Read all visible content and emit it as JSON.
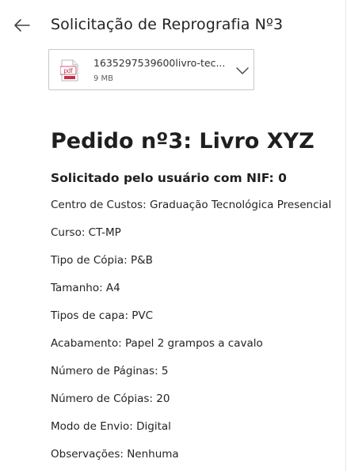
{
  "header": {
    "title": "Solicitação de Reprografia Nº3"
  },
  "attachment": {
    "file_name": "1635297539600livro-tec...",
    "file_size": "9 MB",
    "file_type_label": "pdf",
    "icon": "pdf-file-icon"
  },
  "colors": {
    "pdf_icon": "#c4314b",
    "text": "#242424"
  },
  "order": {
    "title": "Pedido nº3: Livro XYZ",
    "requested_by": "Solicitado pelo usuário com NIF: 0",
    "details": [
      "Centro de Custos: Graduação Tecnológica Presencial",
      "Curso: CT-MP",
      "Tipo de Cópia: P&B",
      "Tamanho: A4",
      "Tipos de capa: PVC",
      "Acabamento: Papel 2 grampos a cavalo",
      "Número de Páginas: 5",
      "Número de Cópias: 20",
      "Modo de Envio: Digital",
      "Observações: Nenhuma"
    ]
  }
}
